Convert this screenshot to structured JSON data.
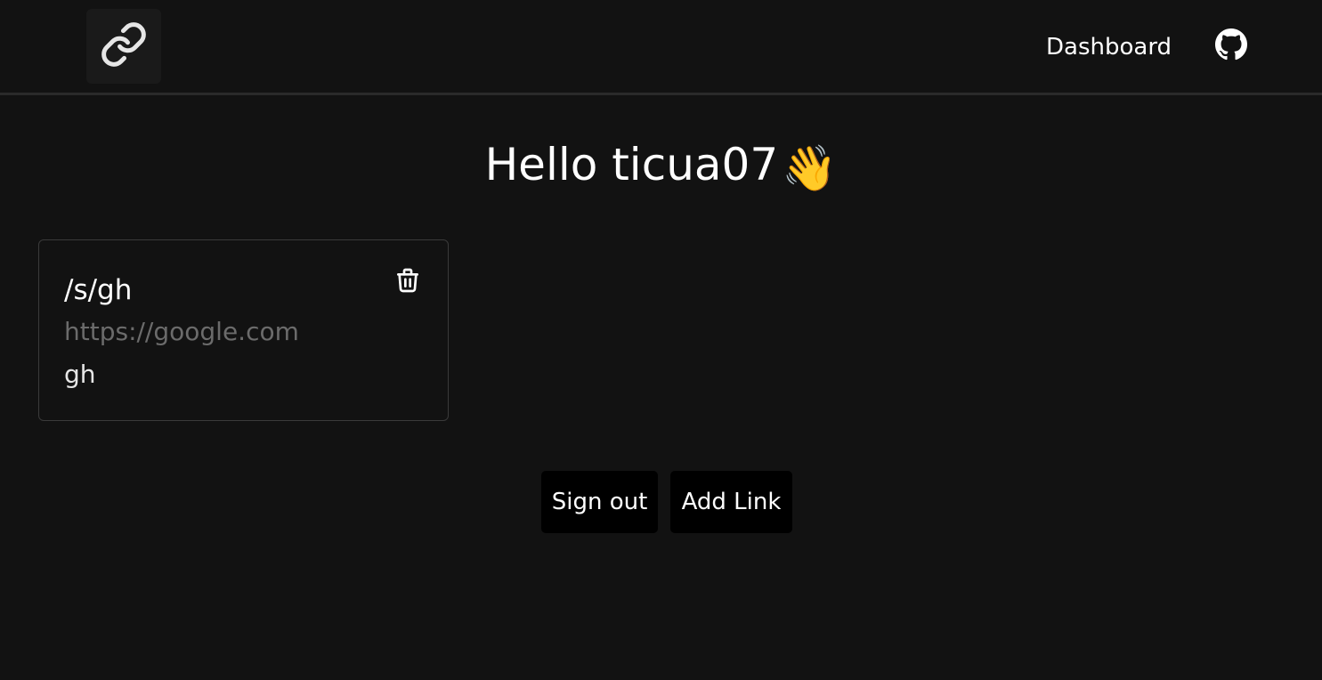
{
  "header": {
    "logo_icon": "link-icon",
    "nav_label": "Dashboard",
    "github_icon": "github-icon"
  },
  "greeting": {
    "text": "Hello ticua07",
    "emoji": "👋"
  },
  "links": [
    {
      "slug": "/s/gh",
      "url": "https://google.com",
      "description": "gh",
      "delete_icon": "trash-icon"
    }
  ],
  "actions": {
    "sign_out_label": "Sign out",
    "add_link_label": "Add Link"
  },
  "colors": {
    "background": "#121212",
    "text": "#ffffff",
    "muted_text": "#6b6b6b",
    "button_bg": "#000000",
    "border": "#3a3a3a"
  }
}
